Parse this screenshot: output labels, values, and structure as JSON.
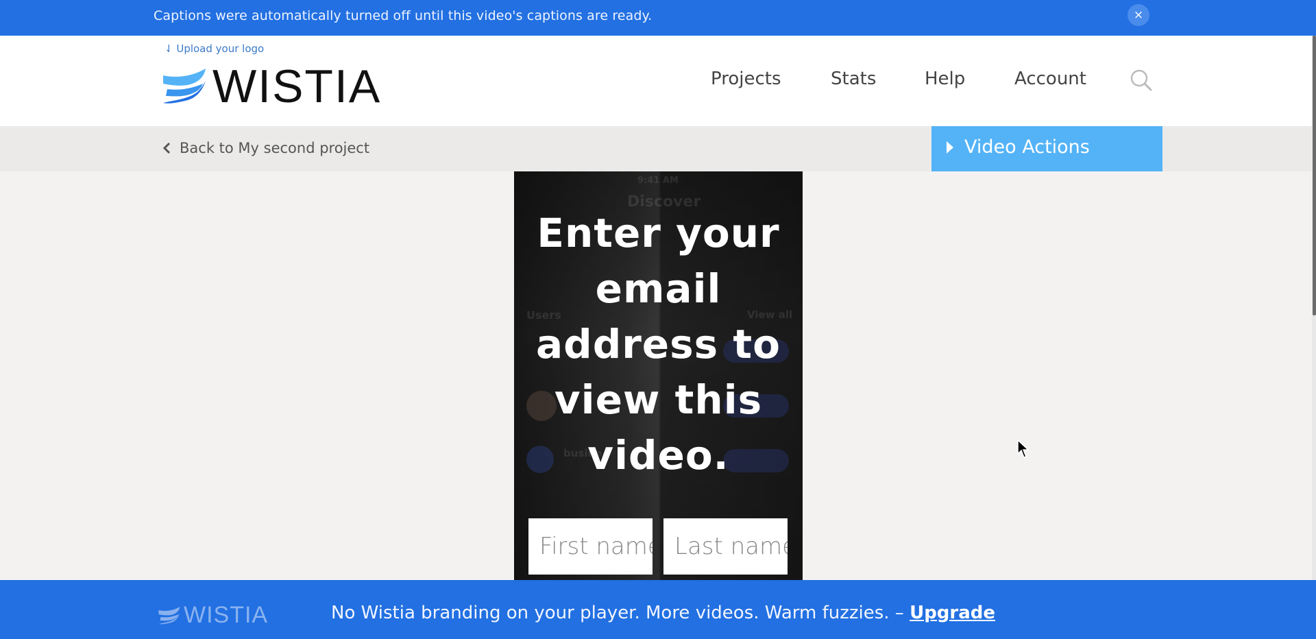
{
  "caption_banner": {
    "message": "Captions were automatically turned off until this video's captions are ready.",
    "close_icon": "×"
  },
  "header": {
    "upload_logo_label": "⇃ Upload your logo",
    "brand_name": "WISTIA",
    "nav": [
      {
        "label": "Projects"
      },
      {
        "label": "Stats"
      },
      {
        "label": "Help"
      },
      {
        "label": "Account"
      }
    ],
    "search_icon": "search-icon"
  },
  "subbar": {
    "back_label": "Back to My second project",
    "video_actions_label": "Video Actions"
  },
  "video": {
    "gate_title_lines": [
      "Enter your",
      "email",
      "address to",
      "view this",
      "video."
    ],
    "first_name_placeholder": "First name",
    "last_name_placeholder": "Last name",
    "background_text": {
      "status_time": "9:41 AM",
      "heading": "Discover",
      "section": "Users",
      "view_all": "View all",
      "user_partial": "busine"
    }
  },
  "footer": {
    "brand_name": "WISTIA",
    "promo_text": "No Wistia branding on your player. More videos. Warm fuzzies. – ",
    "upgrade_label": "Upgrade"
  },
  "colors": {
    "banner_blue": "#2270e2",
    "video_actions_blue": "#54b3f7",
    "link_blue": "#3d7ac7"
  }
}
